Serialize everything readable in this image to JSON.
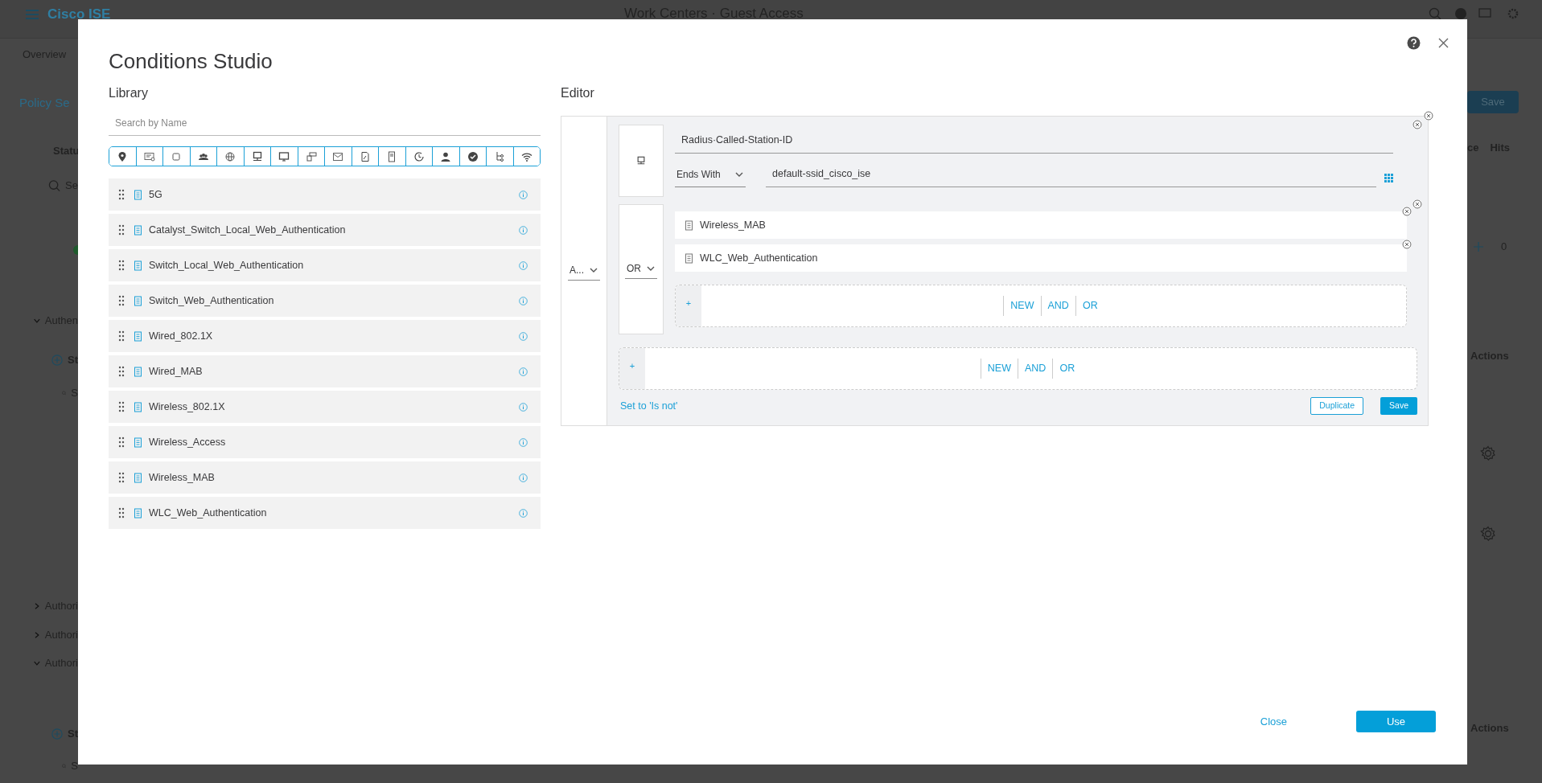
{
  "background": {
    "brand": "Cisco ISE",
    "page_title": "Work Centers · Guest Access",
    "left": [
      {
        "kind": "tab",
        "text": "Overview"
      },
      {
        "kind": "heading",
        "text": "Policy Se"
      },
      {
        "kind": "column",
        "text": "Statu"
      },
      {
        "kind": "search",
        "text": "Se"
      },
      {
        "kind": "dot"
      },
      {
        "kind": "section",
        "text": "Authen",
        "expanded": true
      },
      {
        "kind": "add",
        "text": "St"
      },
      {
        "kind": "search",
        "text": "S"
      },
      {
        "kind": "section",
        "text": "Authori",
        "expanded": false
      },
      {
        "kind": "section",
        "text": "Authori",
        "expanded": false
      },
      {
        "kind": "section",
        "text": "Authori",
        "expanded": true
      },
      {
        "kind": "add",
        "text": "St"
      },
      {
        "kind": "search",
        "text": "S"
      }
    ],
    "right": [
      {
        "kind": "button",
        "text": "Save"
      },
      {
        "kind": "columns",
        "texts": [
          "ce",
          "Hits"
        ]
      },
      {
        "kind": "count",
        "text": "0"
      },
      {
        "kind": "column",
        "text": "Actions"
      },
      {
        "kind": "gear"
      },
      {
        "kind": "gear"
      },
      {
        "kind": "column",
        "text": "Actions"
      }
    ]
  },
  "modal": {
    "title": "Conditions Studio",
    "library": {
      "heading": "Library",
      "search": {
        "placeholder": "Search by Name"
      },
      "items": [
        "5G",
        "Catalyst_Switch_Local_Web_Authentication",
        "Switch_Local_Web_Authentication",
        "Switch_Web_Authentication",
        "Wired_802.1X",
        "Wired_MAB",
        "Wireless_802.1X",
        "Wireless_Access",
        "Wireless_MAB",
        "WLC_Web_Authentication"
      ]
    },
    "editor": {
      "heading": "Editor",
      "operator": "A...",
      "condition": {
        "attribute": "Radius·Called-Station-ID",
        "operator": "Ends With",
        "value": "default-ssid_cisco_ise"
      },
      "group": {
        "operator": "OR",
        "items": [
          "Wireless_MAB",
          "WLC_Web_Authentication"
        ],
        "add": "+",
        "actions": [
          "NEW",
          "AND",
          "OR"
        ]
      },
      "add": "+",
      "actions": [
        "NEW",
        "AND",
        "OR"
      ],
      "set_not": "Set to 'Is not'",
      "buttons": [
        "Duplicate",
        "Save"
      ]
    },
    "footer": {
      "close": "Close",
      "use": "Use"
    }
  }
}
